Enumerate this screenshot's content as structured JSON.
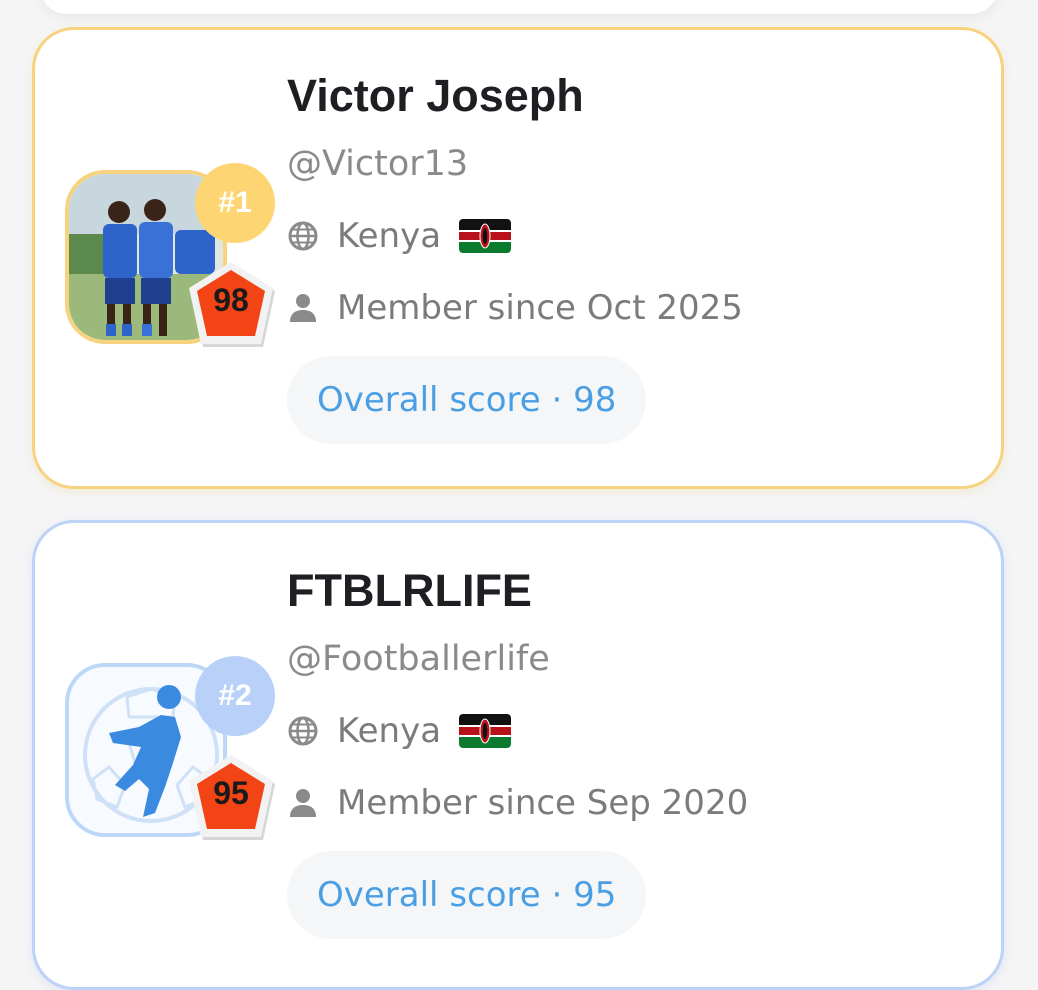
{
  "leaderboard": [
    {
      "rank": "#1",
      "name": "Victor Joseph",
      "handle": "@Victor13",
      "country": "Kenya",
      "member_since": "Member since Oct 2025",
      "score": "98",
      "score_pill": "Overall score · 98",
      "theme_color": "#f7d37f"
    },
    {
      "rank": "#2",
      "name": "FTBLRLIFE",
      "handle": "@Footballerlife",
      "country": "Kenya",
      "member_since": "Member since Sep 2020",
      "score": "95",
      "score_pill": "Overall score · 95",
      "theme_color": "#bcd2f6"
    }
  ],
  "icons": {
    "country": "globe-icon",
    "member": "person-icon",
    "flag": "kenya-flag-icon",
    "badge": "pentagon-score-badge"
  },
  "colors": {
    "accent_text": "#4a9fe4",
    "badge_red": "#f24415",
    "gold": "#fdd673",
    "blue": "#b9d1f8"
  }
}
